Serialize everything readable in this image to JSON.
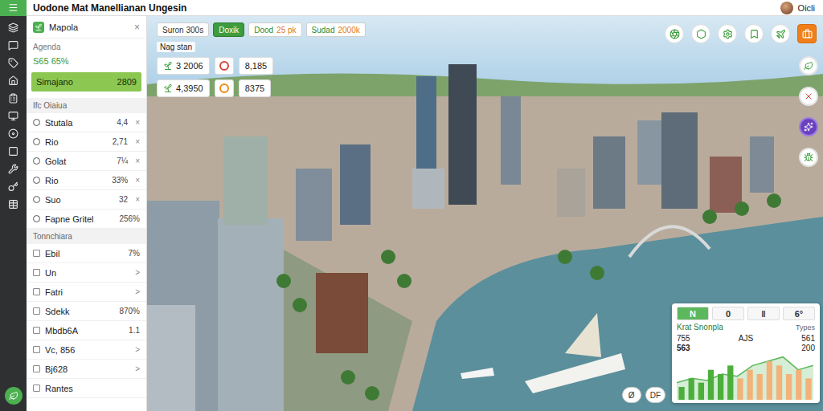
{
  "window": {
    "title": "Uodone Mat Manellianan Ungesin"
  },
  "user": {
    "name": "Oicli"
  },
  "panel": {
    "title": "Mapola",
    "close": "×",
    "agenda": {
      "label": "Agenda",
      "value": "S65 65%"
    },
    "highlight": {
      "label": "Simajano",
      "value": "2809",
      "selected": true
    },
    "sections": [
      {
        "title": "Ifc Oiaiua",
        "kind": "radio",
        "items": [
          {
            "label": "Stutala",
            "value": "4,4",
            "trail": "×",
            "checked": false
          },
          {
            "label": "Rio",
            "value": "2,71",
            "trail": "×",
            "checked": false
          },
          {
            "label": "Golat",
            "value": "7¼",
            "trail": "×",
            "checked": false
          },
          {
            "label": "Rio",
            "value": "33%",
            "trail": "×",
            "checked": false
          },
          {
            "label": "Suo",
            "value": "32",
            "trail": "×",
            "checked": false
          },
          {
            "label": "Fapne Gritel",
            "value": "256%",
            "checked": false
          }
        ]
      },
      {
        "title": "Tonnchiara",
        "kind": "check",
        "items": [
          {
            "label": "Ebil",
            "value": "7%",
            "checked": false
          },
          {
            "label": "Un",
            "trail": ">",
            "checked": false
          },
          {
            "label": "Fatri",
            "trail": ">",
            "checked": false
          },
          {
            "label": "Sdekk",
            "value": "870%",
            "checked": false
          },
          {
            "label": "Mbdb6A",
            "value": "1.1",
            "checked": false
          },
          {
            "label": "Vc, 856",
            "trail": ">",
            "checked": false
          },
          {
            "label": "Bj628",
            "trail": ">",
            "checked": false
          },
          {
            "label": "Rantes",
            "checked": false
          }
        ]
      }
    ]
  },
  "map": {
    "pills": [
      {
        "label": "Suron 300s",
        "selected": false
      },
      {
        "label": "Doxik",
        "selected": true
      },
      {
        "label": "Dood",
        "value": "25 pk",
        "selected": false
      },
      {
        "label": "Sudad",
        "value": "2000k",
        "selected": false
      }
    ],
    "subtitle": "Nag stan",
    "stats": [
      {
        "primary": "3 2006",
        "secondary": "8,185",
        "color": "#d9443a"
      },
      {
        "primary": "4,3950",
        "secondary": "8375",
        "color": "#ef8a1e"
      }
    ],
    "tools": [
      {
        "selected": false
      },
      {
        "selected": false
      },
      {
        "selected": false
      },
      {
        "selected": false
      },
      {
        "selected": false
      },
      {
        "selected": true
      }
    ],
    "side_tools": [
      {
        "selected": false
      },
      {
        "selected": false
      },
      {
        "selected": true
      },
      {
        "selected": false
      }
    ],
    "controls": [
      "Ø",
      "DF"
    ]
  },
  "chart": {
    "tabs": [
      {
        "label": "N",
        "selected": true
      },
      {
        "label": "0",
        "selected": false
      },
      {
        "label": "‖",
        "selected": false
      },
      {
        "label": "6°",
        "selected": false
      }
    ],
    "title": "Krat Snonpla",
    "note": "Types",
    "readings": {
      "left_top": "755",
      "left_bottom": "563",
      "middle": "AJS",
      "right_top": "561",
      "right_bottom": "200"
    },
    "series": [
      {
        "kind": "area",
        "color": "#5cb85c",
        "values": [
          4,
          5,
          4.5,
          6,
          5.5,
          8,
          9,
          10,
          7,
          8
        ]
      },
      {
        "kind": "bar",
        "color": "#4caf3c",
        "values": [
          3,
          5,
          4,
          7,
          6,
          8
        ]
      },
      {
        "kind": "bar",
        "color": "#f2b27a",
        "values": [
          5,
          7,
          6,
          9,
          8,
          6,
          7,
          5
        ]
      }
    ]
  }
}
